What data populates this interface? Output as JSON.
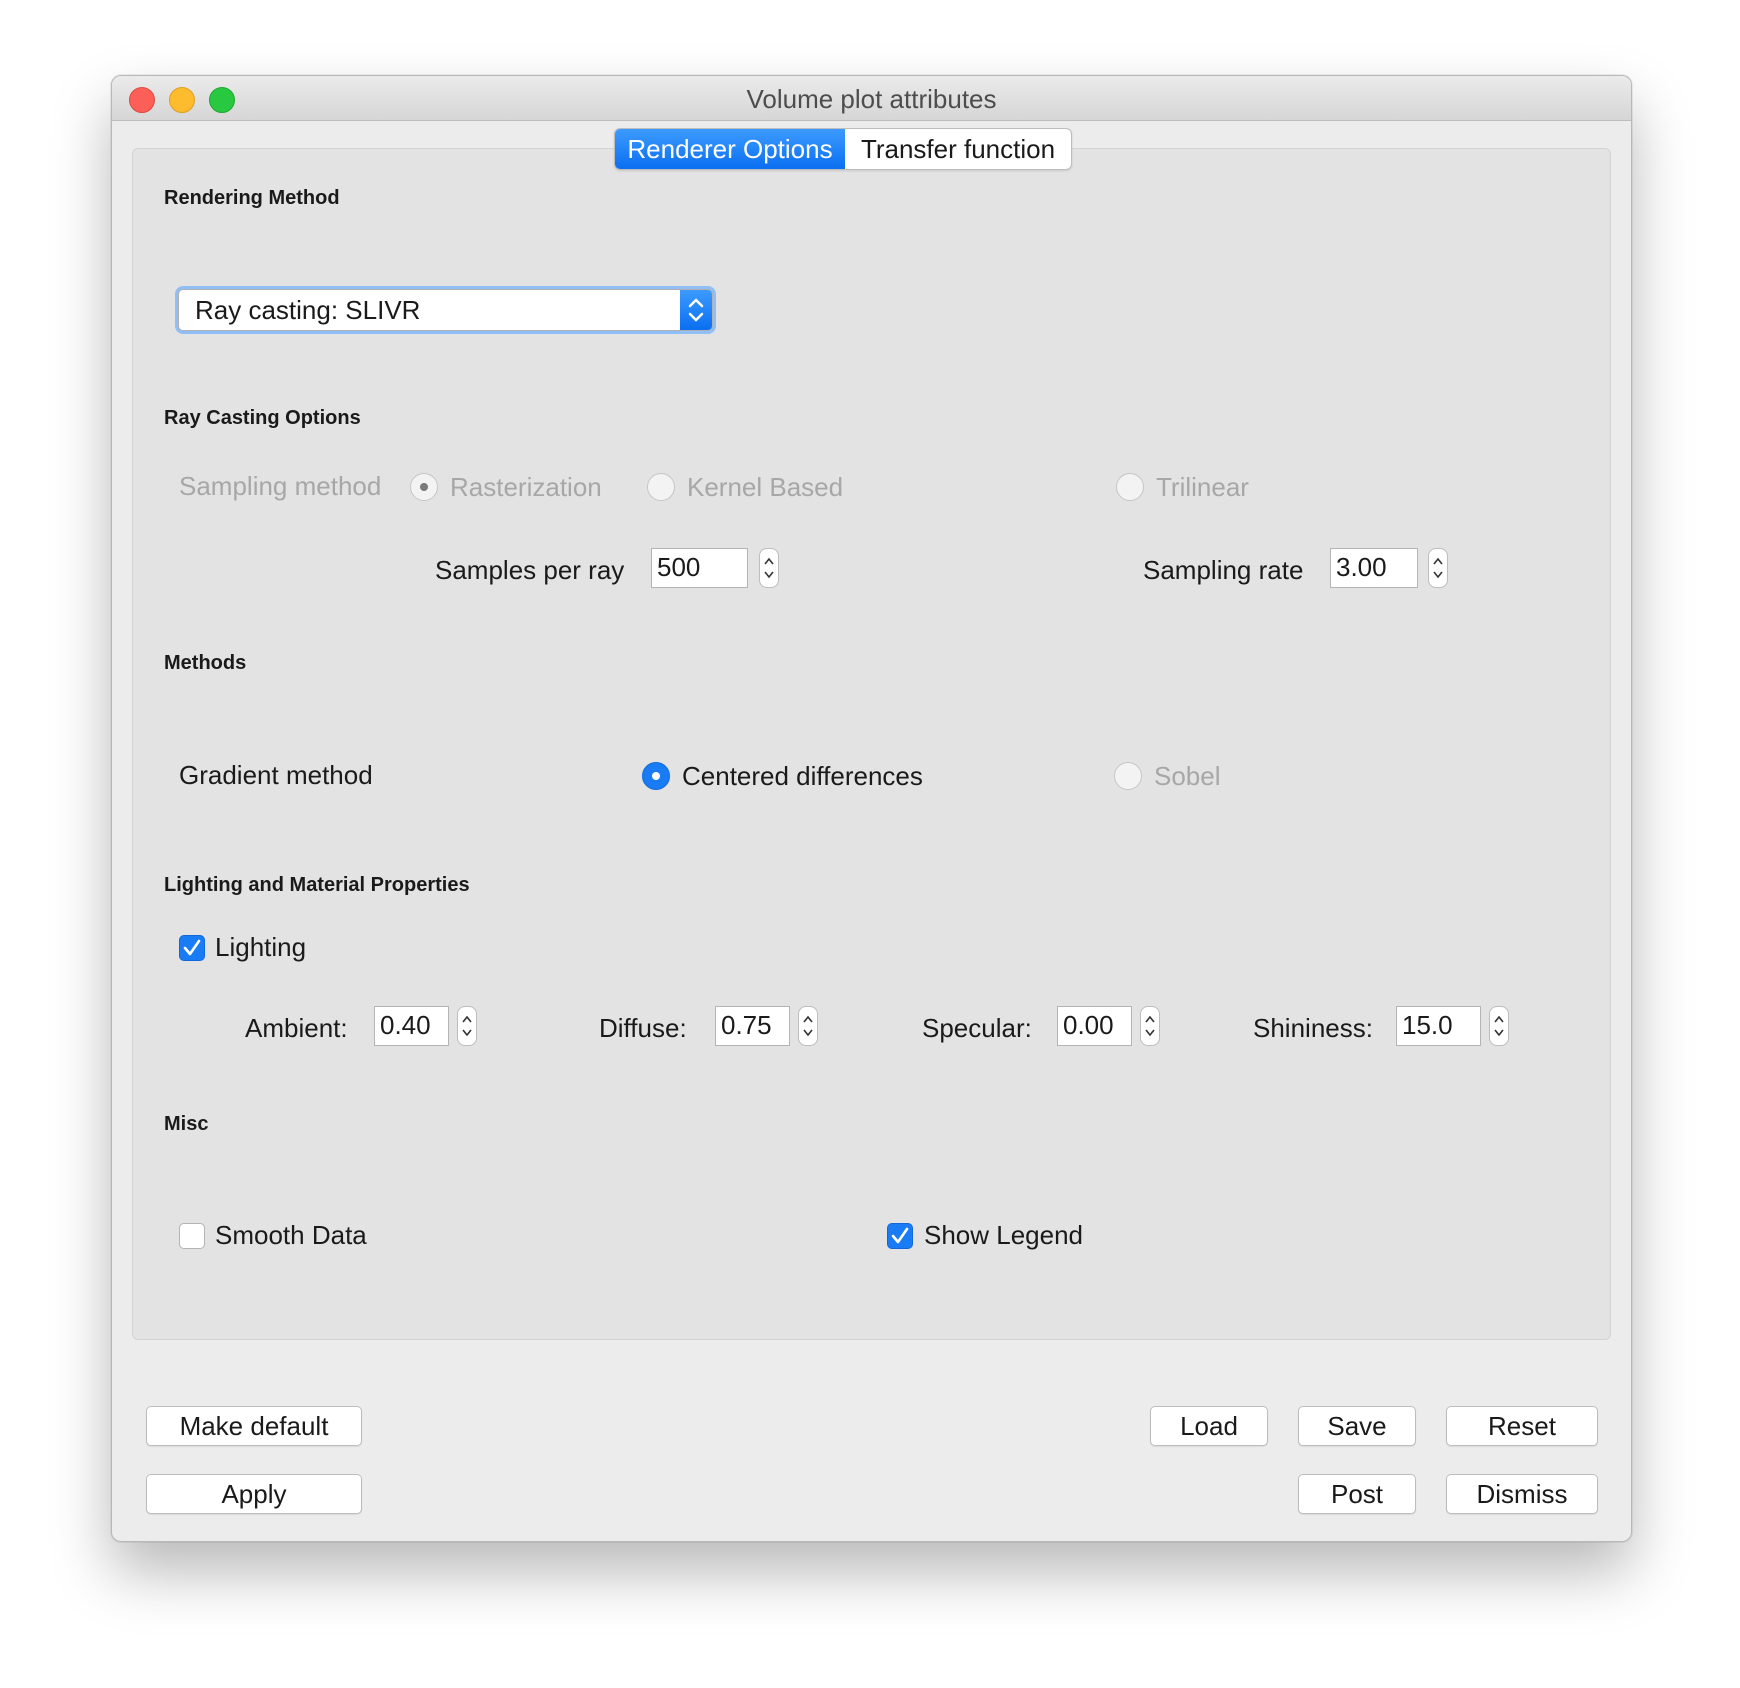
{
  "window": {
    "title": "Volume plot attributes"
  },
  "tabs": [
    {
      "label": "Renderer Options",
      "active": true
    },
    {
      "label": "Transfer function",
      "active": false
    }
  ],
  "rendering_method": {
    "section_title": "Rendering Method",
    "selected": "Ray casting: SLIVR"
  },
  "ray_casting": {
    "section_title": "Ray Casting Options",
    "sampling_label": "Sampling method",
    "sampling_options": [
      "Rasterization",
      "Kernel Based",
      "Trilinear"
    ],
    "sampling_selected": "Rasterization",
    "samples_per_ray_label": "Samples per ray",
    "samples_per_ray": "500",
    "sampling_rate_label": "Sampling rate",
    "sampling_rate": "3.00"
  },
  "methods": {
    "section_title": "Methods",
    "gradient_label": "Gradient method",
    "options": [
      "Centered differences",
      "Sobel"
    ],
    "selected": "Centered differences"
  },
  "lighting": {
    "section_title": "Lighting and Material Properties",
    "lighting_label": "Lighting",
    "lighting_checked": true,
    "ambient_label": "Ambient:",
    "ambient": "0.40",
    "diffuse_label": "Diffuse:",
    "diffuse": "0.75",
    "specular_label": "Specular:",
    "specular": "0.00",
    "shininess_label": "Shininess:",
    "shininess": "15.0"
  },
  "misc": {
    "section_title": "Misc",
    "smooth_label": "Smooth Data",
    "smooth_checked": false,
    "legend_label": "Show Legend",
    "legend_checked": true
  },
  "buttons": {
    "make_default": "Make default",
    "apply": "Apply",
    "load": "Load",
    "save": "Save",
    "reset": "Reset",
    "post": "Post",
    "dismiss": "Dismiss"
  },
  "colors": {
    "accent": "#1a7cf4",
    "disabled_text": "#a7a7a7"
  }
}
